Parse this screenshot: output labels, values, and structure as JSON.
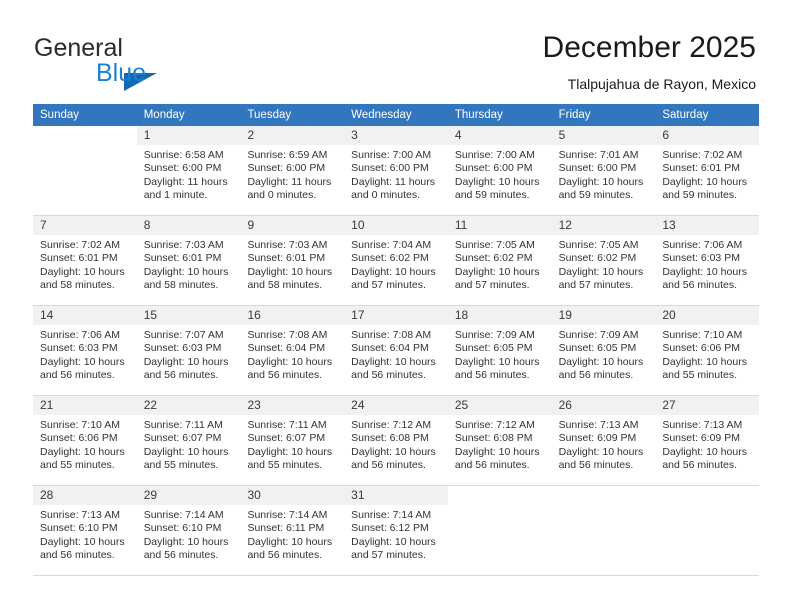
{
  "brand": {
    "word1": "General",
    "word2": "Blue",
    "triangle_color": "#1268b3",
    "word2_color": "#1d7fd0"
  },
  "header": {
    "title": "December 2025",
    "subtitle": "Tlalpujahua de Rayon, Mexico"
  },
  "theme": {
    "header_row_bg": "#3277bd",
    "header_row_text": "#ffffff",
    "daynum_band_bg": "#f1f1f1",
    "grid_line": "#d8d8d8"
  },
  "weekdays": [
    "Sunday",
    "Monday",
    "Tuesday",
    "Wednesday",
    "Thursday",
    "Friday",
    "Saturday"
  ],
  "weeks": [
    [
      {
        "day": "",
        "sunrise": "",
        "sunset": "",
        "daylight1": "",
        "daylight2": ""
      },
      {
        "day": "1",
        "sunrise": "Sunrise: 6:58 AM",
        "sunset": "Sunset: 6:00 PM",
        "daylight1": "Daylight: 11 hours",
        "daylight2": "and 1 minute."
      },
      {
        "day": "2",
        "sunrise": "Sunrise: 6:59 AM",
        "sunset": "Sunset: 6:00 PM",
        "daylight1": "Daylight: 11 hours",
        "daylight2": "and 0 minutes."
      },
      {
        "day": "3",
        "sunrise": "Sunrise: 7:00 AM",
        "sunset": "Sunset: 6:00 PM",
        "daylight1": "Daylight: 11 hours",
        "daylight2": "and 0 minutes."
      },
      {
        "day": "4",
        "sunrise": "Sunrise: 7:00 AM",
        "sunset": "Sunset: 6:00 PM",
        "daylight1": "Daylight: 10 hours",
        "daylight2": "and 59 minutes."
      },
      {
        "day": "5",
        "sunrise": "Sunrise: 7:01 AM",
        "sunset": "Sunset: 6:00 PM",
        "daylight1": "Daylight: 10 hours",
        "daylight2": "and 59 minutes."
      },
      {
        "day": "6",
        "sunrise": "Sunrise: 7:02 AM",
        "sunset": "Sunset: 6:01 PM",
        "daylight1": "Daylight: 10 hours",
        "daylight2": "and 59 minutes."
      }
    ],
    [
      {
        "day": "7",
        "sunrise": "Sunrise: 7:02 AM",
        "sunset": "Sunset: 6:01 PM",
        "daylight1": "Daylight: 10 hours",
        "daylight2": "and 58 minutes."
      },
      {
        "day": "8",
        "sunrise": "Sunrise: 7:03 AM",
        "sunset": "Sunset: 6:01 PM",
        "daylight1": "Daylight: 10 hours",
        "daylight2": "and 58 minutes."
      },
      {
        "day": "9",
        "sunrise": "Sunrise: 7:03 AM",
        "sunset": "Sunset: 6:01 PM",
        "daylight1": "Daylight: 10 hours",
        "daylight2": "and 58 minutes."
      },
      {
        "day": "10",
        "sunrise": "Sunrise: 7:04 AM",
        "sunset": "Sunset: 6:02 PM",
        "daylight1": "Daylight: 10 hours",
        "daylight2": "and 57 minutes."
      },
      {
        "day": "11",
        "sunrise": "Sunrise: 7:05 AM",
        "sunset": "Sunset: 6:02 PM",
        "daylight1": "Daylight: 10 hours",
        "daylight2": "and 57 minutes."
      },
      {
        "day": "12",
        "sunrise": "Sunrise: 7:05 AM",
        "sunset": "Sunset: 6:02 PM",
        "daylight1": "Daylight: 10 hours",
        "daylight2": "and 57 minutes."
      },
      {
        "day": "13",
        "sunrise": "Sunrise: 7:06 AM",
        "sunset": "Sunset: 6:03 PM",
        "daylight1": "Daylight: 10 hours",
        "daylight2": "and 56 minutes."
      }
    ],
    [
      {
        "day": "14",
        "sunrise": "Sunrise: 7:06 AM",
        "sunset": "Sunset: 6:03 PM",
        "daylight1": "Daylight: 10 hours",
        "daylight2": "and 56 minutes."
      },
      {
        "day": "15",
        "sunrise": "Sunrise: 7:07 AM",
        "sunset": "Sunset: 6:03 PM",
        "daylight1": "Daylight: 10 hours",
        "daylight2": "and 56 minutes."
      },
      {
        "day": "16",
        "sunrise": "Sunrise: 7:08 AM",
        "sunset": "Sunset: 6:04 PM",
        "daylight1": "Daylight: 10 hours",
        "daylight2": "and 56 minutes."
      },
      {
        "day": "17",
        "sunrise": "Sunrise: 7:08 AM",
        "sunset": "Sunset: 6:04 PM",
        "daylight1": "Daylight: 10 hours",
        "daylight2": "and 56 minutes."
      },
      {
        "day": "18",
        "sunrise": "Sunrise: 7:09 AM",
        "sunset": "Sunset: 6:05 PM",
        "daylight1": "Daylight: 10 hours",
        "daylight2": "and 56 minutes."
      },
      {
        "day": "19",
        "sunrise": "Sunrise: 7:09 AM",
        "sunset": "Sunset: 6:05 PM",
        "daylight1": "Daylight: 10 hours",
        "daylight2": "and 56 minutes."
      },
      {
        "day": "20",
        "sunrise": "Sunrise: 7:10 AM",
        "sunset": "Sunset: 6:06 PM",
        "daylight1": "Daylight: 10 hours",
        "daylight2": "and 55 minutes."
      }
    ],
    [
      {
        "day": "21",
        "sunrise": "Sunrise: 7:10 AM",
        "sunset": "Sunset: 6:06 PM",
        "daylight1": "Daylight: 10 hours",
        "daylight2": "and 55 minutes."
      },
      {
        "day": "22",
        "sunrise": "Sunrise: 7:11 AM",
        "sunset": "Sunset: 6:07 PM",
        "daylight1": "Daylight: 10 hours",
        "daylight2": "and 55 minutes."
      },
      {
        "day": "23",
        "sunrise": "Sunrise: 7:11 AM",
        "sunset": "Sunset: 6:07 PM",
        "daylight1": "Daylight: 10 hours",
        "daylight2": "and 55 minutes."
      },
      {
        "day": "24",
        "sunrise": "Sunrise: 7:12 AM",
        "sunset": "Sunset: 6:08 PM",
        "daylight1": "Daylight: 10 hours",
        "daylight2": "and 56 minutes."
      },
      {
        "day": "25",
        "sunrise": "Sunrise: 7:12 AM",
        "sunset": "Sunset: 6:08 PM",
        "daylight1": "Daylight: 10 hours",
        "daylight2": "and 56 minutes."
      },
      {
        "day": "26",
        "sunrise": "Sunrise: 7:13 AM",
        "sunset": "Sunset: 6:09 PM",
        "daylight1": "Daylight: 10 hours",
        "daylight2": "and 56 minutes."
      },
      {
        "day": "27",
        "sunrise": "Sunrise: 7:13 AM",
        "sunset": "Sunset: 6:09 PM",
        "daylight1": "Daylight: 10 hours",
        "daylight2": "and 56 minutes."
      }
    ],
    [
      {
        "day": "28",
        "sunrise": "Sunrise: 7:13 AM",
        "sunset": "Sunset: 6:10 PM",
        "daylight1": "Daylight: 10 hours",
        "daylight2": "and 56 minutes."
      },
      {
        "day": "29",
        "sunrise": "Sunrise: 7:14 AM",
        "sunset": "Sunset: 6:10 PM",
        "daylight1": "Daylight: 10 hours",
        "daylight2": "and 56 minutes."
      },
      {
        "day": "30",
        "sunrise": "Sunrise: 7:14 AM",
        "sunset": "Sunset: 6:11 PM",
        "daylight1": "Daylight: 10 hours",
        "daylight2": "and 56 minutes."
      },
      {
        "day": "31",
        "sunrise": "Sunrise: 7:14 AM",
        "sunset": "Sunset: 6:12 PM",
        "daylight1": "Daylight: 10 hours",
        "daylight2": "and 57 minutes."
      },
      {
        "day": "",
        "sunrise": "",
        "sunset": "",
        "daylight1": "",
        "daylight2": ""
      },
      {
        "day": "",
        "sunrise": "",
        "sunset": "",
        "daylight1": "",
        "daylight2": ""
      },
      {
        "day": "",
        "sunrise": "",
        "sunset": "",
        "daylight1": "",
        "daylight2": ""
      }
    ]
  ]
}
